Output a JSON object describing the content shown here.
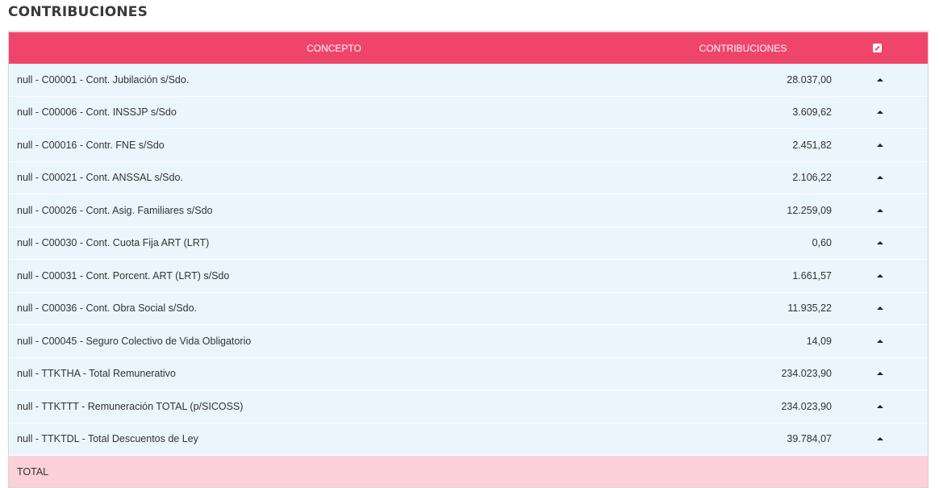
{
  "page": {
    "title": "CONTRIBUCIONES"
  },
  "table": {
    "headers": {
      "concept": "CONCEPTO",
      "value": "CONTRIBUCIONES",
      "action_icon": "edit-icon"
    },
    "rows": [
      {
        "concept": "null - C00001 - Cont. Jubilación s/Sdo.",
        "value": "28.037,00"
      },
      {
        "concept": "null - C00006 - Cont. INSSJP s/Sdo",
        "value": "3.609,62"
      },
      {
        "concept": "null - C00016 - Contr. FNE s/Sdo",
        "value": "2.451,82"
      },
      {
        "concept": "null - C00021 - Cont. ANSSAL s/Sdo.",
        "value": "2.106,22"
      },
      {
        "concept": "null - C00026 - Cont. Asig. Familiares s/Sdo",
        "value": "12.259,09"
      },
      {
        "concept": "null - C00030 - Cont. Cuota Fija ART (LRT)",
        "value": "0,60"
      },
      {
        "concept": "null - C00031 - Cont. Porcent. ART (LRT) s/Sdo",
        "value": "1.661,57"
      },
      {
        "concept": "null - C00036 - Cont. Obra Social s/Sdo.",
        "value": "11.935,22"
      },
      {
        "concept": "null - C00045 - Seguro Colectivo de Vida Obligatorio",
        "value": "14,09"
      },
      {
        "concept": "null - TTKTHA - Total Remunerativo",
        "value": "234.023,90"
      },
      {
        "concept": "null - TTKTTT - Remuneración TOTAL (p/SICOSS)",
        "value": "234.023,90"
      },
      {
        "concept": "null - TTKTDL - Total Descuentos de Ley",
        "value": "39.784,07"
      }
    ],
    "row_action_icon": "caret-up-icon",
    "total": {
      "label": "TOTAL",
      "value": ""
    }
  },
  "colors": {
    "header_bg": "#f0456b",
    "row_bg": "#eaf5fc",
    "total_bg": "#fcd0d8"
  }
}
